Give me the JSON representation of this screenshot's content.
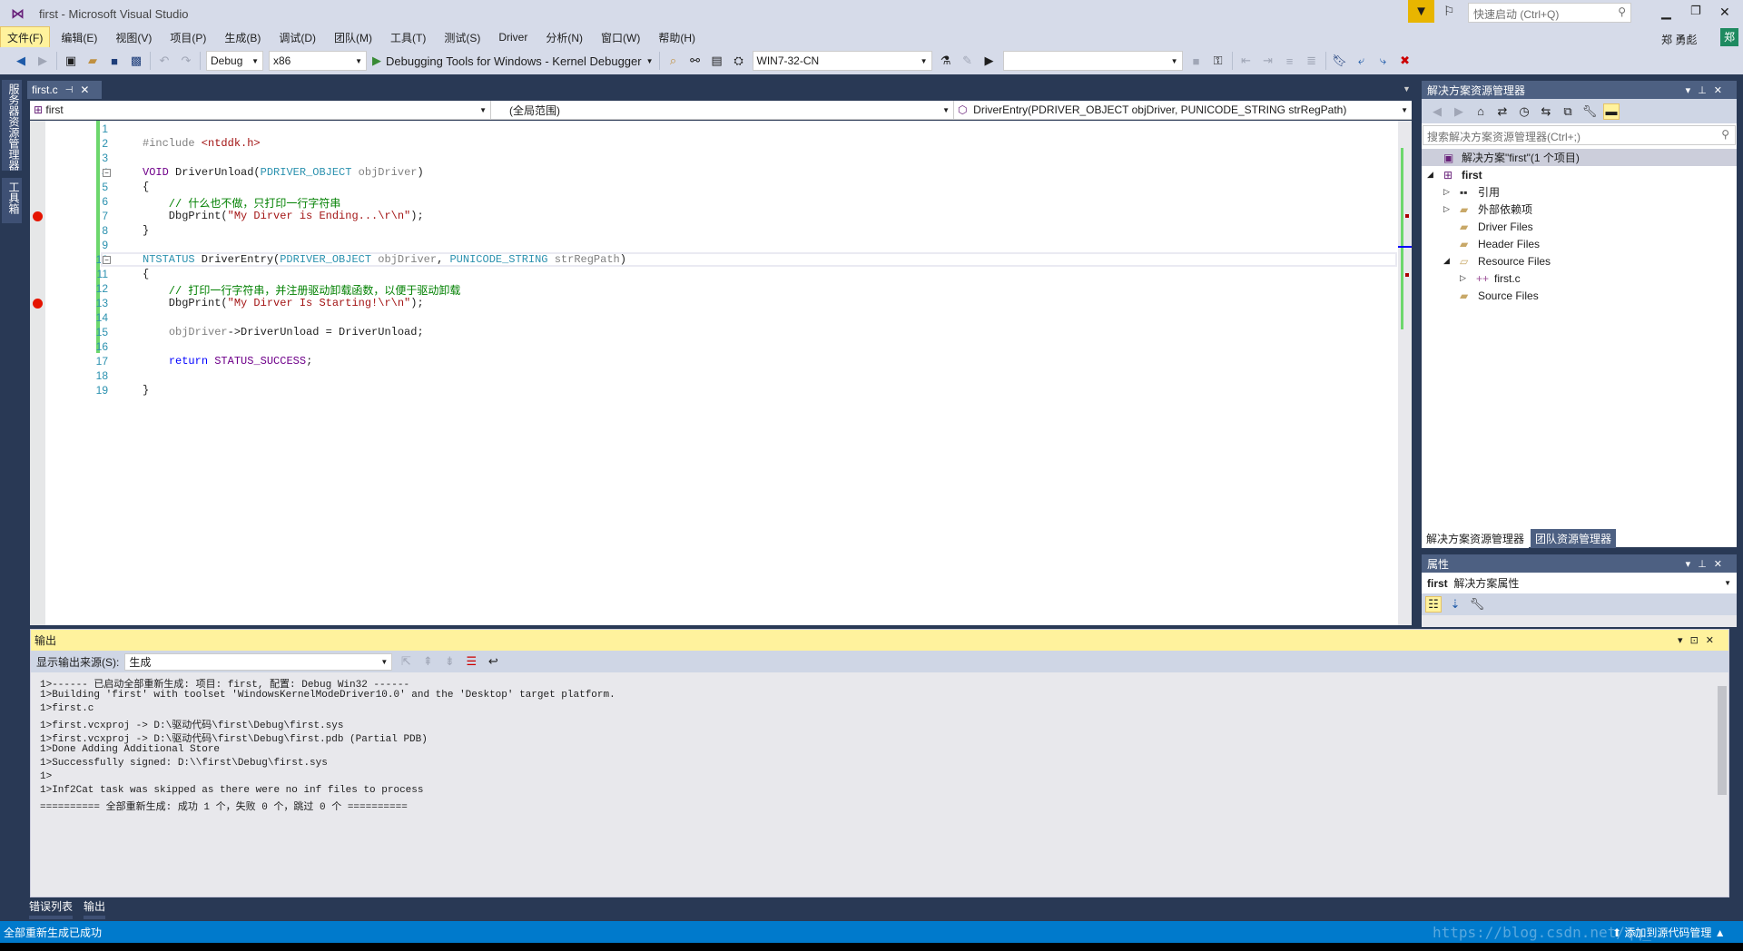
{
  "window": {
    "title": "first - Microsoft Visual Studio",
    "quick_launch_placeholder": "快速启动 (Ctrl+Q)",
    "user": "郑 勇彪",
    "user_avatar": "郑"
  },
  "menu": [
    "文件(F)",
    "编辑(E)",
    "视图(V)",
    "项目(P)",
    "生成(B)",
    "调试(D)",
    "团队(M)",
    "工具(T)",
    "测试(S)",
    "Driver",
    "分析(N)",
    "窗口(W)",
    "帮助(H)"
  ],
  "toolbar": {
    "config": "Debug",
    "platform": "x86",
    "debugger": "Debugging Tools for Windows - Kernel Debugger",
    "target": "WIN7-32-CN",
    "empty_combo": ""
  },
  "left_tabs": [
    "服务器资源管理器",
    "工具箱"
  ],
  "editor": {
    "tab": "first.c",
    "project_combo": "first",
    "scope_combo": "(全局范围)",
    "member_combo": "DriverEntry(PDRIVER_OBJECT objDriver, PUNICODE_STRING strRegPath)",
    "breakpoint_lines": [
      7,
      13
    ],
    "lines": [
      "",
      "#include <ntddk.h>",
      "",
      "VOID DriverUnload(PDRIVER_OBJECT objDriver)",
      "{",
      "    // 什么也不做，只打印一行字符串",
      "    DbgPrint(\"My Dirver is Ending...\\r\\n\");",
      "}",
      "",
      "NTSTATUS DriverEntry(PDRIVER_OBJECT objDriver, PUNICODE_STRING strRegPath)",
      "{",
      "    // 打印一行字符串，并注册驱动卸载函数，以便于驱动卸载",
      "    DbgPrint(\"My Dirver Is Starting!\\r\\n\");",
      "",
      "    objDriver->DriverUnload = DriverUnload;",
      "",
      "    return STATUS_SUCCESS;",
      "",
      "}"
    ]
  },
  "output": {
    "title": "输出",
    "source_label": "显示输出来源(S):",
    "source_value": "生成",
    "lines": [
      "1>------ 已启动全部重新生成: 项目: first, 配置: Debug Win32 ------",
      "1>Building 'first' with toolset 'WindowsKernelModeDriver10.0' and the 'Desktop' target platform.",
      "1>first.c",
      "1>first.vcxproj -> D:\\驱动代码\\first\\Debug\\first.sys",
      "1>first.vcxproj -> D:\\驱动代码\\first\\Debug\\first.pdb (Partial PDB)",
      "1>Done Adding Additional Store",
      "1>Successfully signed: D:\\\\first\\Debug\\first.sys",
      "1>",
      "1>Inf2Cat task was skipped as there were no inf files to process",
      "========== 全部重新生成: 成功 1 个，失败 0 个，跳过 0 个 =========="
    ]
  },
  "bottom_tabs": [
    "错误列表",
    "输出"
  ],
  "solution_explorer": {
    "title": "解决方案资源管理器",
    "search_placeholder": "搜索解决方案资源管理器(Ctrl+;)",
    "items": [
      {
        "label": "解决方案\"first\"(1 个项目)",
        "level": 0
      },
      {
        "label": "first",
        "level": 0
      },
      {
        "label": "引用",
        "level": 1
      },
      {
        "label": "外部依赖项",
        "level": 1
      },
      {
        "label": "Driver Files",
        "level": 1
      },
      {
        "label": "Header Files",
        "level": 1
      },
      {
        "label": "Resource Files",
        "level": 1
      },
      {
        "label": "first.c",
        "level": 2
      },
      {
        "label": "Source Files",
        "level": 1
      }
    ],
    "tabs": [
      "解决方案资源管理器",
      "团队资源管理器"
    ]
  },
  "properties": {
    "title": "属性",
    "object": "first",
    "object_type": "解决方案属性"
  },
  "status": {
    "message": "全部重新生成已成功",
    "source_control": "添加到源代码管理",
    "watermark": "https://blog.csdn.net/qq_"
  },
  "colors": {
    "accent": "#007acc",
    "highlight": "#fff29d",
    "dark": "#293955"
  }
}
